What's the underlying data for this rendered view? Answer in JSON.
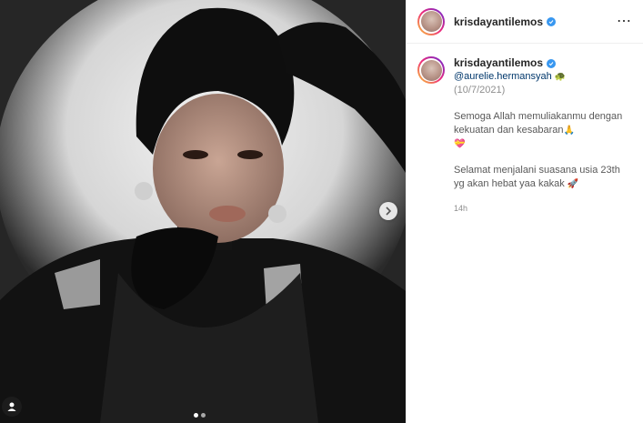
{
  "post": {
    "username": "krisdayantilemos",
    "more_icon": "⋯",
    "caption": {
      "mention": "@aurelie.hermansyah",
      "mention_emoji": "🐢",
      "date": "(10/7/2021)",
      "line1": "Semoga Allah memuliakanmu dengan kekuatan dan kesabaran",
      "line1_emoji": "🙏",
      "line1_emoji2": "💝",
      "line2": "Selamat menjalani suasana usia 23th yg akan hebat yaa kakak",
      "line2_emoji": "🚀",
      "timestamp": "14h"
    },
    "carousel": {
      "current": 1,
      "total": 2
    },
    "colors": {
      "verified": "#3897f0",
      "link": "#00376b",
      "muted": "#8e8e8e"
    }
  }
}
